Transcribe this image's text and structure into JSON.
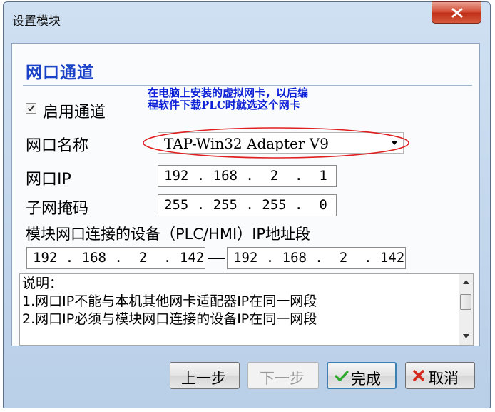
{
  "window": {
    "title": "设置模块"
  },
  "section": {
    "title": "网口通道"
  },
  "enable": {
    "label": "启用通道",
    "checked": true
  },
  "note": {
    "line1": "在电脑上安装的虚拟网卡，以后编",
    "line2": "程软件下载PLC时就选这个网卡"
  },
  "port_name": {
    "label": "网口名称",
    "value": "TAP-Win32 Adapter V9"
  },
  "port_ip": {
    "label": "网口IP",
    "value": "192 . 168 .  2  .  1"
  },
  "subnet": {
    "label": "子网掩码",
    "value": "255 . 255 . 255 .  0"
  },
  "range": {
    "label": "模块网口连接的设备（PLC/HMI）IP地址段",
    "start": "192 . 168 .  2  . 142",
    "end": "192 . 168 .  2  . 142"
  },
  "memo": {
    "line1": "说明：",
    "line2": "1.网口IP不能与本机其他网卡适配器IP在同一网段",
    "line3": "2.网口IP必须与模块网口连接的设备IP在同一网段"
  },
  "buttons": {
    "prev": "上一步",
    "next": "下一步",
    "finish": "完成",
    "cancel": "取消"
  },
  "colors": {
    "accent_title": "#1a43c8",
    "note_text": "#0b1fd6",
    "annotation_ellipse": "#e02020",
    "close_button": "#c9452d"
  },
  "icons": {
    "close": "close-icon",
    "check": "checkmark-icon",
    "dropdown": "dropdown-arrow-icon",
    "finish": "green-check-icon",
    "cancel": "red-x-icon"
  }
}
